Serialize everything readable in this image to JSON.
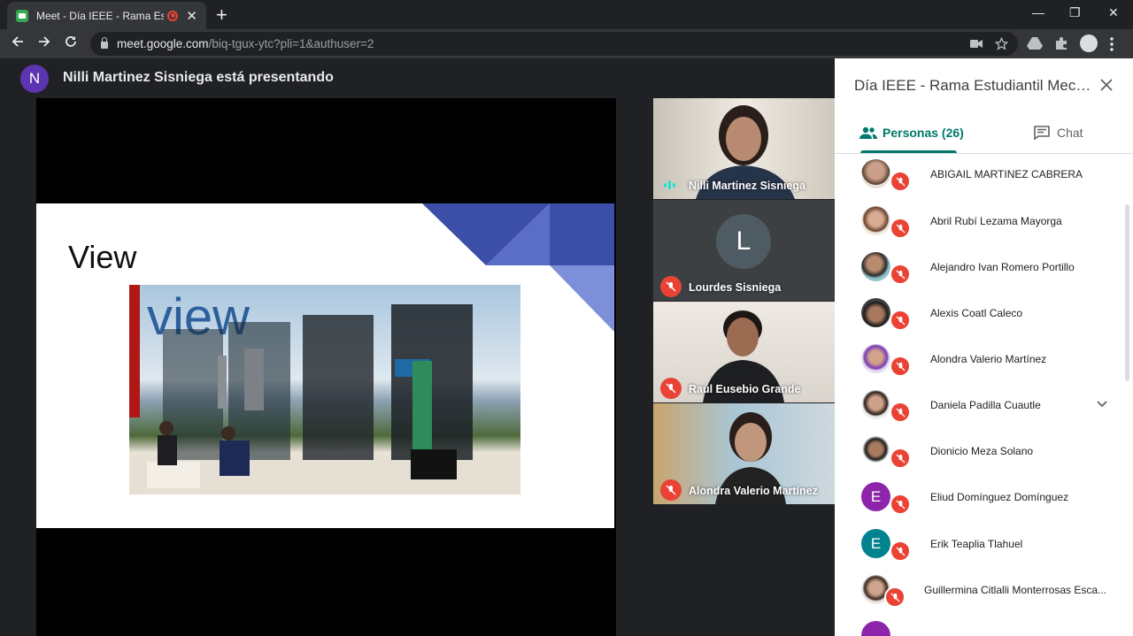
{
  "browser": {
    "tab_title": "Meet - Día IEEE - Rama Estudiantil Mecatrónica",
    "tab_close": "✕",
    "new_tab": "+",
    "url_host": "meet.google.com",
    "url_path": "/biq-tgux-ytc?pli=1&authuser=2",
    "window": {
      "minimize": "—",
      "maximize": "❐",
      "close": "✕"
    }
  },
  "meet": {
    "presenter_initial": "N",
    "presenting_text": "Nilli Martinez Sisniega está presentando",
    "slide": {
      "title": "View",
      "photo_sign": "view"
    },
    "tiles": [
      {
        "name": "Nilli Martinez Sisniega",
        "speaking": true
      },
      {
        "name": "Lourdes Sisniega",
        "initial": "L",
        "muted": true
      },
      {
        "name": "Raúl Eusebio Grande",
        "muted": true
      },
      {
        "name": "Alondra Valerio Martínez",
        "muted": true
      }
    ]
  },
  "panel": {
    "title": "Día IEEE - Rama Estudiantil Mecat...",
    "tab_people": "Personas (26)",
    "tab_chat": "Chat",
    "people": [
      {
        "name": "ABIGAIL MARTINEZ CABRERA",
        "avatar": "photo"
      },
      {
        "name": "Abril Rubí Lezama Mayorga",
        "avatar": "photo"
      },
      {
        "name": "Alejandro Ivan Romero Portillo",
        "avatar": "photo"
      },
      {
        "name": "Alexis Coatl Caleco",
        "avatar": "photo"
      },
      {
        "name": "Alondra Valerio Martínez",
        "avatar": "photo"
      },
      {
        "name": "Daniela Padilla Cuautle",
        "avatar": "photo",
        "expand": true
      },
      {
        "name": "Dionicio Meza Solano",
        "avatar": "photo"
      },
      {
        "name": "Eliud Domínguez Domínguez",
        "avatar": "letter",
        "initial": "E",
        "color": "#8e24aa"
      },
      {
        "name": "Erik Teaplia Tlahuel",
        "avatar": "letter",
        "initial": "E",
        "color": "#00838f"
      },
      {
        "name": "Guillermina Citlalli Monterrosas Esca...",
        "avatar": "photo"
      }
    ]
  },
  "colors": {
    "mute_red": "#ea4335",
    "teal": "#00796b",
    "dark_bg": "#202124"
  }
}
